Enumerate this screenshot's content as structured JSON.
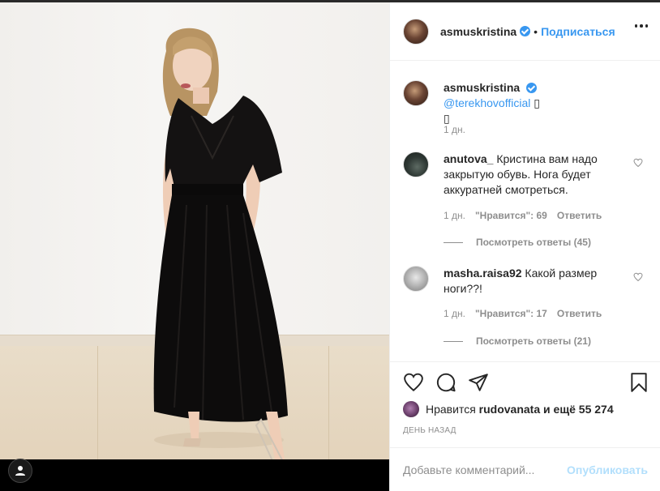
{
  "post": {
    "author": "asmuskristina",
    "separator": "•",
    "follow_label": "Подписаться"
  },
  "caption": {
    "author": "asmuskristina",
    "mention": "@terekhovofficial",
    "emoji_1": "▯",
    "emoji_2": "▯",
    "time": "1 дн."
  },
  "comments": [
    {
      "author": "anutova_",
      "text": "Кристина вам надо закрытую обувь. Нога будет аккуратней смотреться.",
      "time": "1 дн.",
      "likes": "\"Нравится\": 69",
      "reply_label": "Ответить",
      "view_replies": "Посмотреть ответы (45)"
    },
    {
      "author": "masha.raisa92",
      "text": "Какой размер ноги??!",
      "time": "1 дн.",
      "likes": "\"Нравится\": 17",
      "reply_label": "Ответить",
      "view_replies": "Посмотреть ответы (21)"
    }
  ],
  "likes_bar": {
    "prefix": "Нравится",
    "user": "rudovanata",
    "suffix": "и ещё 55 274"
  },
  "posted_time": "ДЕНЬ НАЗАД",
  "composer": {
    "placeholder": "Добавьте комментарий...",
    "publish_label": "Опубликовать"
  },
  "icons": {
    "like": "heart-icon",
    "comment": "comment-icon",
    "share": "share-icon",
    "save": "bookmark-icon",
    "more": "more-options-icon",
    "tag": "user-tag-icon"
  },
  "colors": {
    "link": "#3897f0",
    "muted": "#8e8e8e",
    "text": "#262626",
    "publish_disabled": "#b2dffc"
  }
}
